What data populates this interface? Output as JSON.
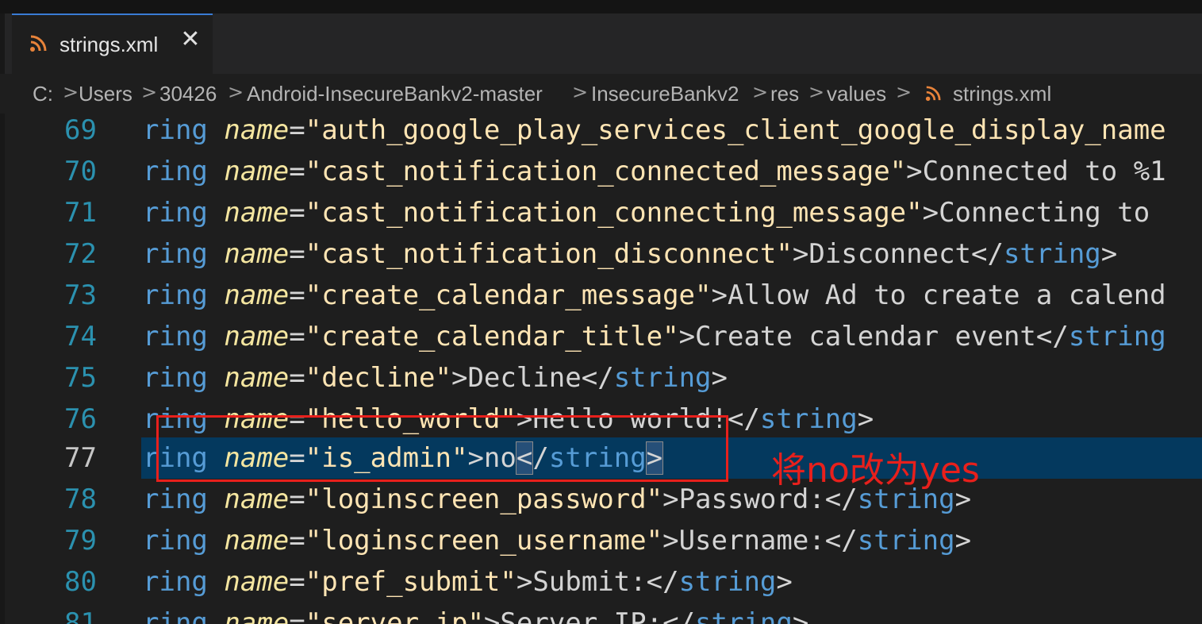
{
  "tab": {
    "label": "strings.xml",
    "icon": "rss-icon",
    "close_glyph": "✕",
    "accent_color": "#3a7bd5"
  },
  "breadcrumb": {
    "items": [
      "C:",
      "Users",
      "30426",
      "Android-InsecureBankv2-master",
      "InsecureBankv2",
      "res",
      "values"
    ],
    "file": "strings.xml",
    "separator": ">"
  },
  "code": {
    "current_line": "77",
    "lines": [
      {
        "num": "69",
        "tag": "ring",
        "attr": "name",
        "value": "\"auth_google_play_services_client_google_display_name",
        "text": ""
      },
      {
        "num": "70",
        "tag": "ring",
        "attr": "name",
        "value": "\"cast_notification_connected_message\"",
        "text": ">Connected to %1"
      },
      {
        "num": "71",
        "tag": "ring",
        "attr": "name",
        "value": "\"cast_notification_connecting_message\"",
        "text": ">Connecting to"
      },
      {
        "num": "72",
        "tag": "ring",
        "attr": "name",
        "value": "\"cast_notification_disconnect\"",
        "text": ">Disconnect</",
        "close": "string",
        "end": ">"
      },
      {
        "num": "73",
        "tag": "ring",
        "attr": "name",
        "value": "\"create_calendar_message\"",
        "text": ">Allow Ad to create a calend"
      },
      {
        "num": "74",
        "tag": "ring",
        "attr": "name",
        "value": "\"create_calendar_title\"",
        "text": ">Create calendar event</",
        "close": "string",
        "end": ""
      },
      {
        "num": "75",
        "tag": "ring",
        "attr": "name",
        "value": "\"decline\"",
        "text": ">Decline</",
        "close": "string",
        "end": ">"
      },
      {
        "num": "76",
        "tag": "ring",
        "attr": "name",
        "value": "\"hello_world\"",
        "text": ">Hello world!</",
        "close": "string",
        "end": ">"
      },
      {
        "num": "77",
        "tag": "ring",
        "attr": "name",
        "value": "\"is_admin\"",
        "text": ">no",
        "bracket": "<",
        "mid": "/",
        "close": "string",
        "end": ">"
      },
      {
        "num": "78",
        "tag": "ring",
        "attr": "name",
        "value": "\"loginscreen_password\"",
        "text": ">Password:</",
        "close": "string",
        "end": ">"
      },
      {
        "num": "79",
        "tag": "ring",
        "attr": "name",
        "value": "\"loginscreen_username\"",
        "text": ">Username:</",
        "close": "string",
        "end": ">"
      },
      {
        "num": "80",
        "tag": "ring",
        "attr": "name",
        "value": "\"pref_submit\"",
        "text": ">Submit:</",
        "close": "string",
        "end": ">"
      },
      {
        "num": "81",
        "tag": "ring",
        "attr": "name",
        "value": "\"server_ip\"",
        "text": ">Server IP:</",
        "close": "string",
        "end": ">"
      }
    ]
  },
  "annotation": {
    "text": "将no改为yes",
    "color": "#e8201c"
  }
}
